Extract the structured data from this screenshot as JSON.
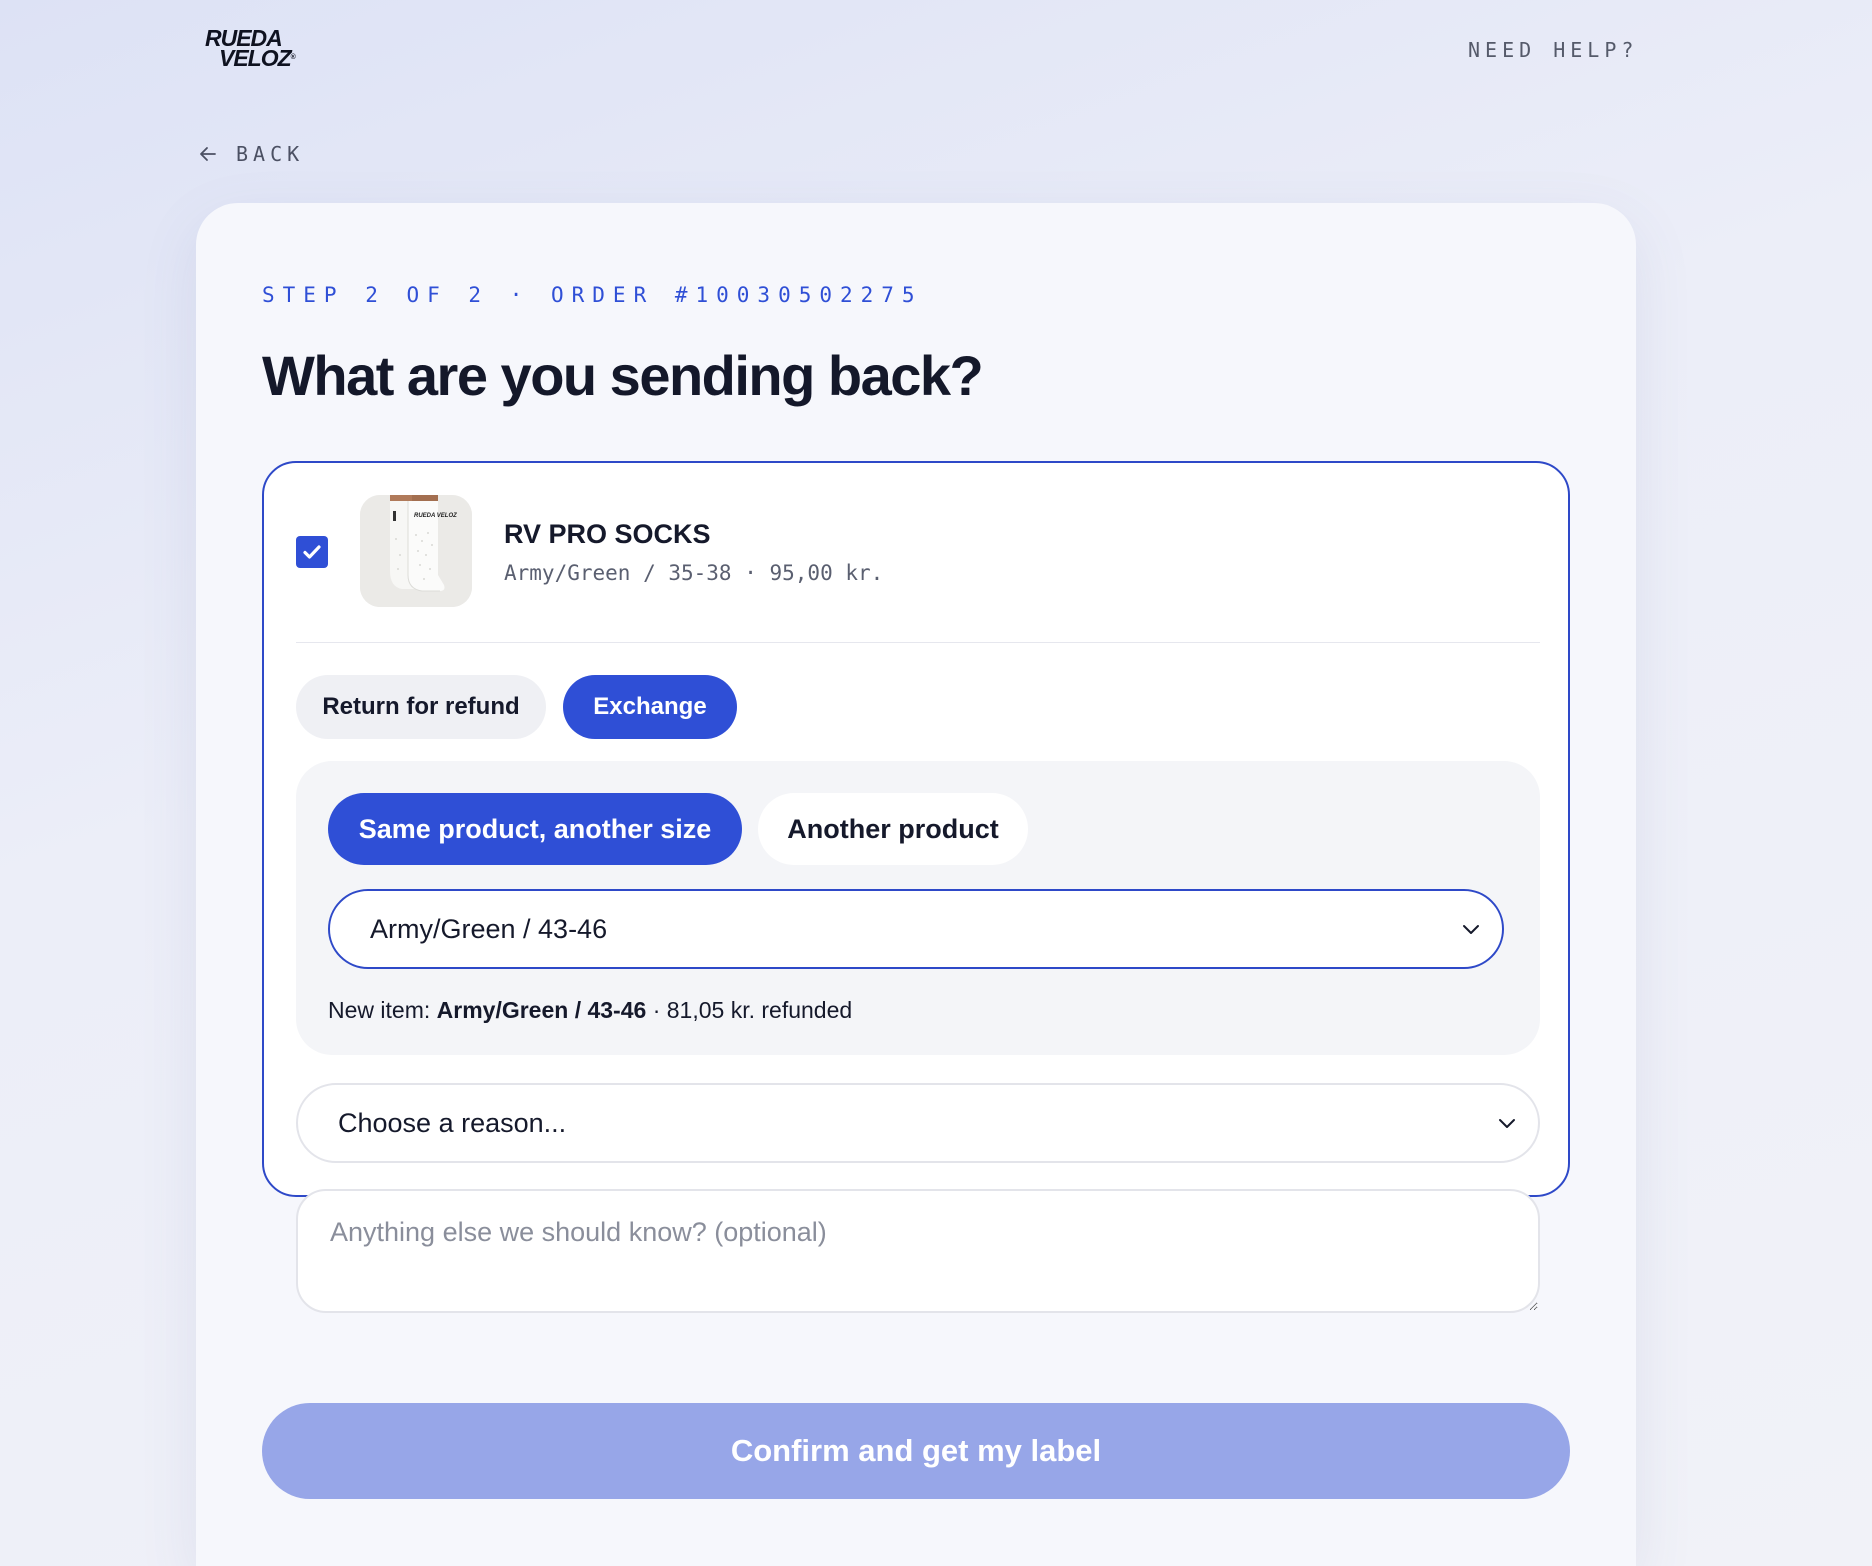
{
  "brand": {
    "logo_line1": "RUEDA",
    "logo_line2": "VELOZ",
    "logo_mark": "®"
  },
  "header": {
    "help_label": "NEED HELP?"
  },
  "nav": {
    "back_label": "BACK"
  },
  "page": {
    "step_label": "STEP 2 OF 2 · ORDER #10030502275",
    "title": "What are you sending back?"
  },
  "item": {
    "checked": true,
    "name": "RV PRO SOCKS",
    "meta": "Army/Green / 35-38 · 95,00 kr.",
    "thumb_print": "RUEDA VELOZ"
  },
  "return_type": {
    "refund_label": "Return for refund",
    "exchange_label": "Exchange",
    "selected": "exchange"
  },
  "exchange": {
    "same_product_label": "Same product, another size",
    "another_product_label": "Another product",
    "selected_option": "same_product",
    "size_select_value": "Army/Green / 43-46",
    "new_item_prefix": "New item:",
    "new_item_value": "Army/Green / 43-46",
    "new_item_suffix": "· 81,05 kr. refunded"
  },
  "reason": {
    "select_value": "Choose a reason..."
  },
  "notes": {
    "placeholder": "Anything else we should know? (optional)"
  },
  "actions": {
    "confirm_label": "Confirm and get my label"
  },
  "colors": {
    "accent": "#2f4fd6",
    "confirm_disabled": "#97a6e8",
    "title": "#14182a"
  },
  "icons": {
    "back": "arrow-left-icon",
    "check": "check-icon",
    "dropdown": "chevron-down-icon"
  }
}
